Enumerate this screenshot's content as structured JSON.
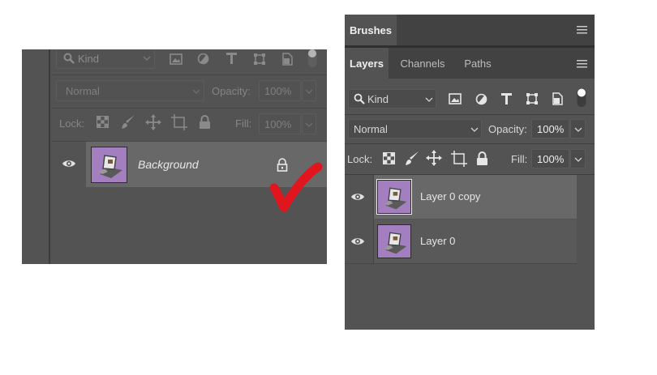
{
  "left_panel": {
    "filter": {
      "kind_label": "Kind"
    },
    "blend": {
      "mode": "Normal",
      "opacity_label": "Opacity:",
      "opacity_value": "100%"
    },
    "lock": {
      "lock_label": "Lock:",
      "fill_label": "Fill:",
      "fill_value": "100%"
    },
    "layer": {
      "name": "Background"
    }
  },
  "right_panel": {
    "top_tab": {
      "label": "Brushes"
    },
    "tabs": [
      {
        "label": "Layers"
      },
      {
        "label": "Channels"
      },
      {
        "label": "Paths"
      }
    ],
    "filter": {
      "kind_label": "Kind"
    },
    "blend": {
      "mode": "Normal",
      "opacity_label": "Opacity:",
      "opacity_value": "100%"
    },
    "lock": {
      "lock_label": "Lock:",
      "fill_label": "Fill:",
      "fill_value": "100%"
    },
    "layers": [
      {
        "name": "Layer 0 copy"
      },
      {
        "name": "Layer 0"
      }
    ]
  },
  "colors": {
    "panel_bg": "#535353",
    "selected_row": "#686868",
    "checkmark": "#e0151d",
    "thumbnail": "#a47fc0"
  }
}
